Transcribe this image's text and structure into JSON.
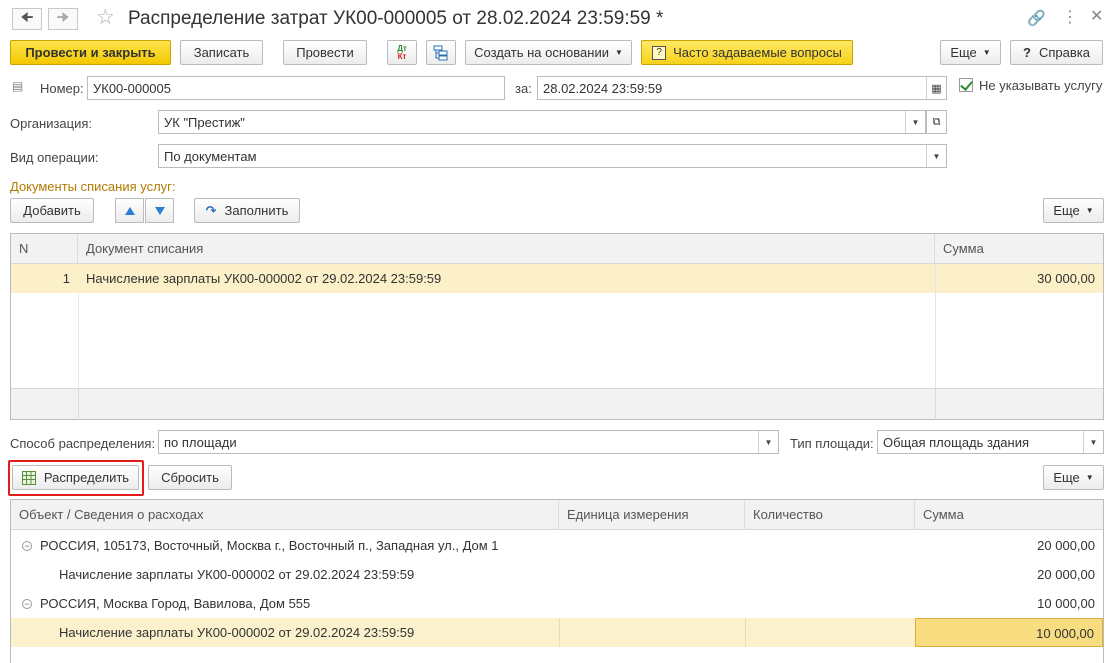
{
  "window": {
    "title": "Распределение затрат УК00-000005 от 28.02.2024 23:59:59 *",
    "back_icon": "arrow-left-icon",
    "forward_icon": "arrow-right-icon",
    "favorite_icon": "star-icon",
    "link_icon": "link-icon",
    "more_icon": "vertical-dots-icon",
    "close_icon": "close-icon"
  },
  "toolbar": {
    "post_close": "Провести и закрыть",
    "save": "Записать",
    "post": "Провести",
    "dt_kt_top": "Дт",
    "dt_kt_bottom": "Кт",
    "create_based": "Создать на основании",
    "faq": "Часто задаваемые вопросы",
    "faq_icon": "?",
    "more": "Еще",
    "help": "Справка",
    "help_icon": "?"
  },
  "form": {
    "number_label": "Номер:",
    "number_value": "УК00-000005",
    "date_label": "за:",
    "date_value": "28.02.2024 23:59:59",
    "no_service_label": "Не указывать услугу",
    "no_service_checked": true,
    "org_label": "Организация:",
    "org_value": "УК \"Престиж\"",
    "op_label": "Вид операции:",
    "op_value": "По документам"
  },
  "docs_section": {
    "title": "Документы списания услуг:",
    "add": "Добавить",
    "fill": "Заполнить",
    "more": "Еще",
    "columns": {
      "n": "N",
      "doc": "Документ списания",
      "sum": "Сумма"
    },
    "rows": [
      {
        "n": "1",
        "doc": "Начисление зарплаты УК00-000002 от 29.02.2024 23:59:59",
        "sum": "30 000,00"
      }
    ]
  },
  "distribution": {
    "method_label": "Способ распределения:",
    "method_value": "по площади",
    "area_type_label": "Тип площади:",
    "area_type_value": "Общая площадь здания",
    "distribute": "Распределить",
    "reset": "Сбросить",
    "more": "Еще",
    "columns": {
      "object": "Объект / Сведения о расходах",
      "unit": "Единица измерения",
      "qty": "Количество",
      "sum": "Сумма"
    },
    "rows": [
      {
        "level": 0,
        "object": "РОССИЯ, 105173, Восточный, Москва г., Восточный п., Западная ул., Дом 1",
        "sum": "20 000,00"
      },
      {
        "level": 1,
        "object": "Начисление зарплаты УК00-000002 от 29.02.2024 23:59:59",
        "sum": "20 000,00"
      },
      {
        "level": 0,
        "object": "РОССИЯ, Москва Город, Вавилова, Дом 555",
        "sum": "10 000,00"
      },
      {
        "level": 1,
        "object": "Начисление зарплаты УК00-000002 от 29.02.2024 23:59:59",
        "sum": "10 000,00"
      }
    ]
  },
  "colors": {
    "accent_yellow": "#f3c800",
    "selected_row": "#fbf0c8",
    "section_label": "#b37a00",
    "highlight_frame": "#e11c1c"
  }
}
